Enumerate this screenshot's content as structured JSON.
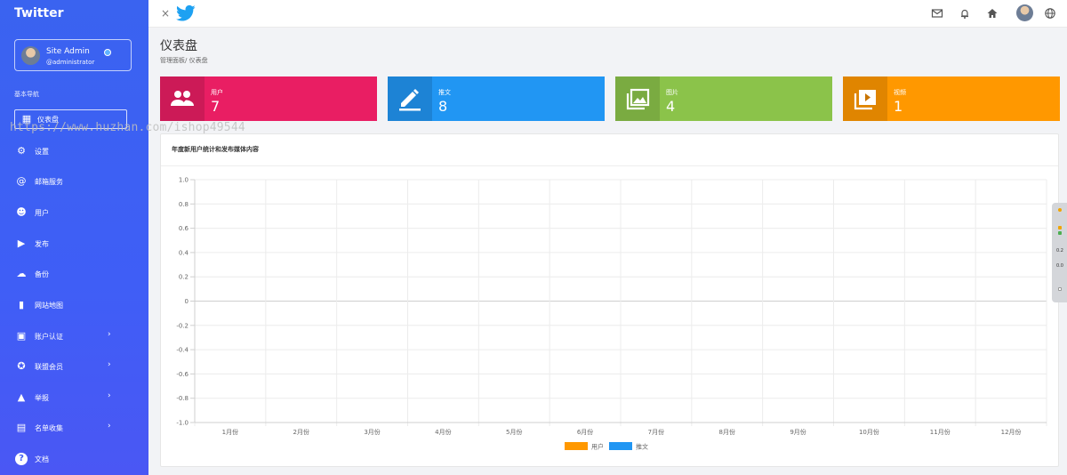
{
  "sidebar": {
    "brand": "Twitter",
    "user": {
      "name": "Site Admin",
      "handle": "@administrator"
    },
    "section_label": "基本导航",
    "items": [
      {
        "label": "仪表盘",
        "icon": "dashboard-icon",
        "active": true,
        "chevron": false
      },
      {
        "label": "设置",
        "icon": "gear-icon",
        "active": false,
        "chevron": false
      },
      {
        "label": "邮箱服务",
        "icon": "at-icon",
        "active": false,
        "chevron": false
      },
      {
        "label": "用户",
        "icon": "user-face-icon",
        "active": false,
        "chevron": false
      },
      {
        "label": "发布",
        "icon": "publish-icon",
        "active": false,
        "chevron": false
      },
      {
        "label": "备份",
        "icon": "cloud-upload-icon",
        "active": false,
        "chevron": false
      },
      {
        "label": "网站地图",
        "icon": "map-icon",
        "active": false,
        "chevron": false
      },
      {
        "label": "账户认证",
        "icon": "verify-icon",
        "active": false,
        "chevron": true
      },
      {
        "label": "联盟会员",
        "icon": "affiliate-icon",
        "active": false,
        "chevron": true
      },
      {
        "label": "举报",
        "icon": "warning-icon",
        "active": false,
        "chevron": true
      },
      {
        "label": "名单收集",
        "icon": "trash-list-icon",
        "active": false,
        "chevron": true
      },
      {
        "label": "文档",
        "icon": "help-icon",
        "active": false,
        "chevron": false
      }
    ]
  },
  "topbar": {
    "close_glyph": "×",
    "icons": [
      "mail-icon",
      "bell-icon",
      "home-icon",
      "avatar",
      "globe-icon"
    ]
  },
  "page": {
    "title": "仪表盘",
    "breadcrumb": "管理面板/ 仪表盘"
  },
  "stats": [
    {
      "label": "用户",
      "value": "7",
      "color": "#e91e63",
      "icon": "people-icon"
    },
    {
      "label": "推文",
      "value": "8",
      "color": "#2196f3",
      "icon": "edit-icon"
    },
    {
      "label": "图片",
      "value": "4",
      "color": "#8bc34a",
      "icon": "image-icon"
    },
    {
      "label": "视频",
      "value": "1",
      "color": "#ff9800",
      "icon": "video-icon"
    }
  ],
  "watermark": "https://www.huzhan.com/ishop49544",
  "chart_data": {
    "type": "bar",
    "title": "年度新用户统计和发布媒体内容",
    "categories": [
      "1月份",
      "2月份",
      "3月份",
      "4月份",
      "5月份",
      "6月份",
      "7月份",
      "8月份",
      "9月份",
      "10月份",
      "11月份",
      "12月份"
    ],
    "series": [
      {
        "name": "用户",
        "color": "#ff9800",
        "values": [
          0,
          0,
          0,
          0,
          0,
          0,
          0,
          0,
          0,
          0,
          0,
          0
        ]
      },
      {
        "name": "推文",
        "color": "#2196f3",
        "values": [
          0,
          0,
          0,
          0,
          0,
          0,
          0,
          0,
          0,
          0,
          0,
          0
        ]
      }
    ],
    "y_ticks": [
      "1.0",
      "0.8",
      "0.6",
      "0.4",
      "0.2",
      "0",
      "-0.2",
      "-0.4",
      "-0.6",
      "-0.8",
      "-1.0"
    ],
    "ylim": [
      -1.0,
      1.0
    ],
    "grid": true,
    "legend_position": "bottom"
  },
  "scroll_widget": {
    "values": [
      "0.2",
      "0.0"
    ]
  }
}
